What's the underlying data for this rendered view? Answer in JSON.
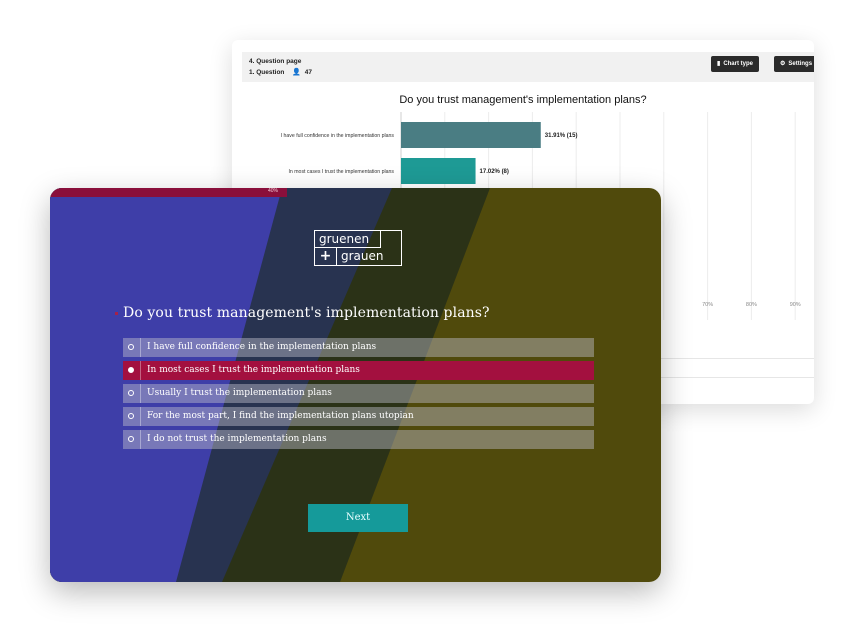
{
  "results_panel": {
    "breadcrumb_page": "4. Question page",
    "question_ref": "1. Question",
    "respondent_count": "47",
    "chart_type_button": "Chart type",
    "settings_button": "Settings",
    "chart_type_icon": "bar-chart-icon",
    "settings_icon": "gear-icon",
    "person_icon": "person-icon"
  },
  "chart_data": {
    "type": "bar",
    "orientation": "horizontal",
    "title": "Do you trust management's implementation plans?",
    "categories": [
      "I have full confidence in the implementation plans",
      "In most cases I trust the implementation plans"
    ],
    "values": [
      31.91,
      17.02
    ],
    "counts": [
      15,
      8
    ],
    "value_labels": [
      "31.91% (15)",
      "17.02% (8)"
    ],
    "bar_colors": [
      "#4a7d83",
      "#1e9a95"
    ],
    "xlim": [
      0,
      100
    ],
    "x_tick_labels_visible": [
      "70%",
      "80%",
      "90%"
    ],
    "grid": true
  },
  "survey": {
    "progress_percent": 40,
    "progress_label": "40%",
    "logo_top": "gruenen",
    "logo_plus": "+",
    "logo_bottom": "grauen",
    "question": "Do you trust management's implementation plans?",
    "answers": [
      {
        "label": "I have full confidence in the implementation plans",
        "selected": false
      },
      {
        "label": "In most cases I trust the implementation plans",
        "selected": true
      },
      {
        "label": "Usually I trust the implementation plans",
        "selected": false
      },
      {
        "label": "For the most part, I find the implementation plans utopian",
        "selected": false
      },
      {
        "label": "I do not trust the implementation plans",
        "selected": false
      }
    ],
    "next_button": "Next",
    "colors": {
      "blue": "#3e3ea8",
      "navy": "#283350",
      "dark_olive": "#2b3217",
      "olive": "#504a0c",
      "selected": "#a3103f",
      "button": "#159a9a"
    }
  }
}
